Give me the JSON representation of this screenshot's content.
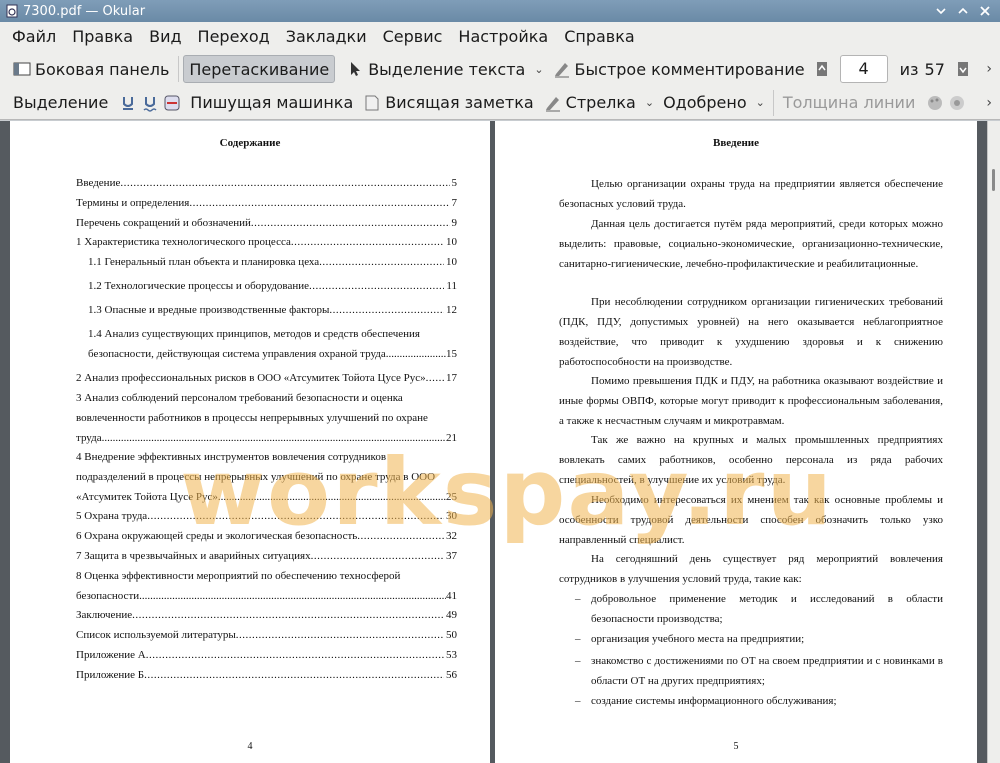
{
  "window": {
    "title": "7300.pdf  — Okular"
  },
  "menu": [
    "Файл",
    "Правка",
    "Вид",
    "Переход",
    "Закладки",
    "Сервис",
    "Настройка",
    "Справка"
  ],
  "toolbar1": {
    "sidebar": "Боковая панель",
    "drag": "Перетаскивание",
    "text_select": "Выделение текста",
    "quick_comment": "Быстрое комментирование",
    "page_current": "4",
    "page_of": "из",
    "page_total": "57"
  },
  "toolbar2": {
    "selection": "Выделение",
    "typewriter": "Пишущая машинка",
    "sticky_note": "Висящая заметка",
    "arrow": "Стрелка",
    "approved": "Одобрено",
    "line_width": "Толщина линии"
  },
  "left_page": {
    "heading": "Содержание",
    "page_number": "4",
    "toc": [
      {
        "text": "Введение",
        "page": "5"
      },
      {
        "text": "Термины и определения",
        "page": "7"
      },
      {
        "text": "Перечень сокращений и обозначений",
        "page": "9"
      },
      {
        "text": "1 Характеристика технологического процесса",
        "page": "10"
      },
      {
        "text": "1.1 Генеральный план объекта и планировка цеха",
        "page": "10"
      },
      {
        "text": "1.2 Технологические процессы и оборудование",
        "page": "11"
      },
      {
        "text": "1.3 Опасные и вредные производственные факторы",
        "page": "12"
      },
      {
        "text1": "1.4 Анализ существующих принципов, методов и средств обеспечения",
        "text2": "безопасности, действующая система управления охраной труда",
        "page": "15"
      },
      {
        "text": "2 Анализ профессиональных рисков в ООО «Атсумитек Тойота Цусе Рус»",
        "page": "17"
      },
      {
        "text1": "3 Анализ соблюдений персоналом требований безопасности и оценка",
        "text2": "вовлеченности работников в процессы непрерывных улучшений по охране",
        "text3": "труда",
        "page": "21"
      },
      {
        "text1": "4 Внедрение эффективных инструментов вовлечения сотрудников",
        "text2": "подразделений в процессы непрерывных улучшений по охране труда в ООО",
        "text3": "«Атсумитек Тойота Цусе Рус»",
        "page": "25"
      },
      {
        "text": "5 Охрана труда",
        "page": "30"
      },
      {
        "text": "6 Охрана окружающей среды и экологическая безопасность",
        "page": "32"
      },
      {
        "text": "7 Защита в чрезвычайных и аварийных ситуациях",
        "page": "37"
      },
      {
        "text1": "8 Оценка эффективности мероприятий по обеспечению техносферой",
        "text2": "безопасности",
        "page": "41"
      },
      {
        "text": "Заключение",
        "page": "49"
      },
      {
        "text": "Список используемой литературы",
        "page": "50"
      },
      {
        "text": "Приложение А",
        "page": "53"
      },
      {
        "text": "Приложение Б",
        "page": "56"
      }
    ]
  },
  "right_page": {
    "heading": "Введение",
    "page_number": "5",
    "paragraphs": [
      "Целью организации охраны труда на предприятии является обеспечение безопасных условий труда.",
      "Данная цель достигается путём ряда мероприятий, среди которых можно выделить: правовые, социально-экономические, организационно-технические, санитарно-гигиенические, лечебно-профилактические и реабилитационные.",
      "При несоблюдении сотрудником организации гигиенических требований (ПДК, ПДУ, допустимых уровней) на него оказывается неблагоприятное воздействие, что приводит к ухудшению здоровья и к снижению работоспособности на производстве.",
      "Помимо превышения ПДК и ПДУ, на работника оказывают воздействие и иные формы ОВПФ, которые могут приводит к профессиональным заболевания, а также к несчастным случаям и микротравмам.",
      "Так же важно на крупных и малых промышленных предприятиях вовлекать самих работников, особенно персонала из ряда рабочих специальностей, в улучшение их условий труда.",
      "Необходимо интересоваться их мнением так как основные проблемы и особенности трудовой деятельности способен обозначить только узко направленный специалист.",
      "На сегодняшний день существует ряд мероприятий вовлечения сотрудников в улучшения условий труда, такие как:"
    ],
    "bullets": [
      "добровольное применение методик и исследований в области безопасности производства;",
      "организация учебного места на предприятии;",
      "знакомство с достижениями по ОТ на своем предприятии и с новинками в области ОТ на других предприятиях;",
      "создание системы информационного обслуживания;"
    ]
  },
  "watermark": "workspay.ru"
}
